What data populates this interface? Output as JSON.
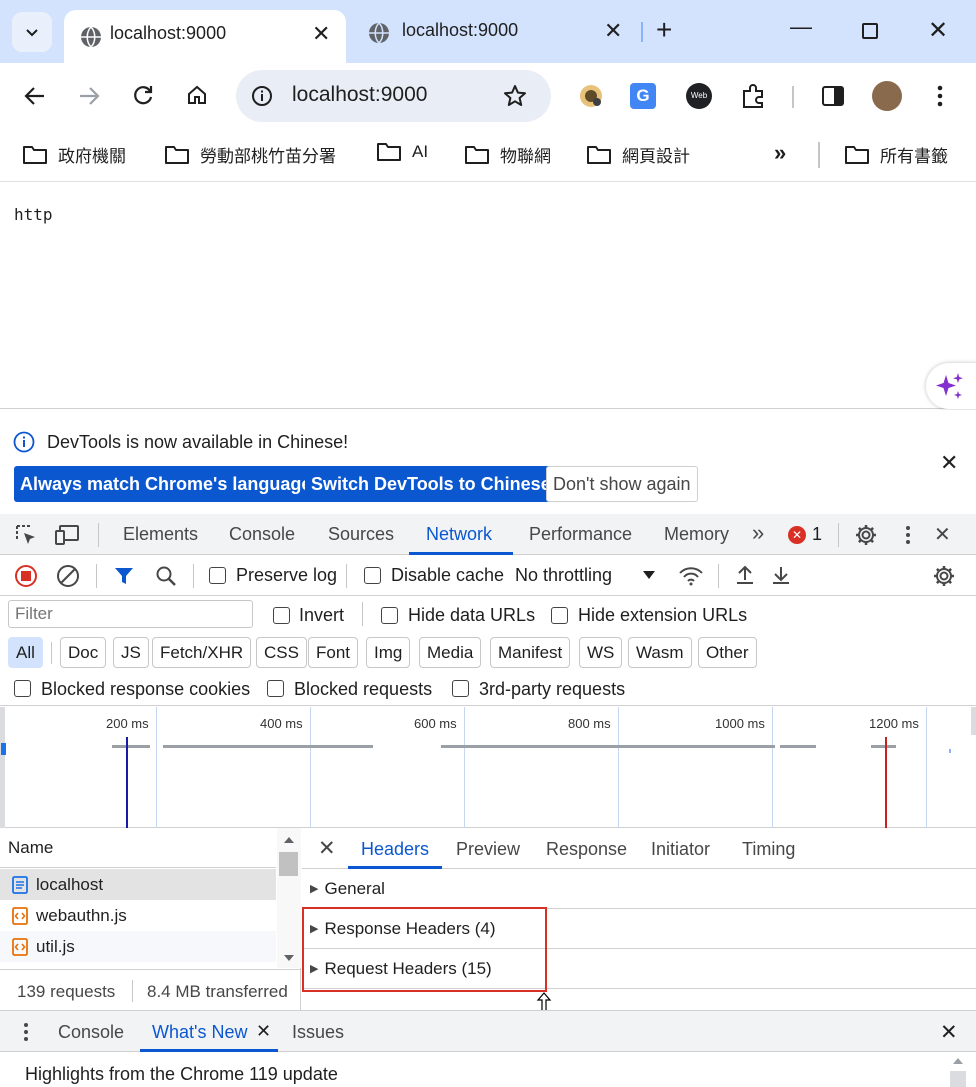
{
  "tabs": [
    {
      "title": "localhost:9000",
      "active": true
    },
    {
      "title": "localhost:9000",
      "active": false
    }
  ],
  "toolbar": {
    "url": "localhost:9000"
  },
  "bookmarks": [
    "政府機關",
    "勞動部桃竹苗分署",
    "AI",
    "物聯網",
    "網頁設計",
    "所有書籤"
  ],
  "page": {
    "body_text": "http"
  },
  "infobar": {
    "message": "DevTools is now available in Chinese!",
    "btn_match": "Always match Chrome's language",
    "btn_switch": "Switch DevTools to Chinese",
    "btn_dismiss": "Don't show again"
  },
  "devtools": {
    "tabs": [
      "Elements",
      "Console",
      "Sources",
      "Network",
      "Performance",
      "Memory"
    ],
    "active_tab": "Network",
    "error_count": "1"
  },
  "network": {
    "preserve_log": "Preserve log",
    "disable_cache": "Disable cache",
    "throttling": "No throttling",
    "filter_placeholder": "Filter",
    "invert": "Invert",
    "hide_data_urls": "Hide data URLs",
    "hide_extension_urls": "Hide extension URLs",
    "type_filters": [
      "All",
      "Doc",
      "JS",
      "Fetch/XHR",
      "CSS",
      "Font",
      "Img",
      "Media",
      "Manifest",
      "WS",
      "Wasm",
      "Other"
    ],
    "blocked_cookies": "Blocked response cookies",
    "blocked_requests": "Blocked requests",
    "third_party": "3rd-party requests",
    "timeline_ticks": [
      "200 ms",
      "400 ms",
      "600 ms",
      "800 ms",
      "1000 ms",
      "1200 ms"
    ],
    "name_header": "Name",
    "requests": [
      {
        "name": "localhost",
        "type": "doc"
      },
      {
        "name": "webauthn.js",
        "type": "script"
      },
      {
        "name": "util.js",
        "type": "script"
      }
    ],
    "summary_requests": "139 requests",
    "summary_transferred": "8.4 MB transferred",
    "detail_tabs": [
      "Headers",
      "Preview",
      "Response",
      "Initiator",
      "Timing"
    ],
    "detail_active": "Headers",
    "sections": [
      "General",
      "Response Headers (4)",
      "Request Headers (15)"
    ]
  },
  "drawer": {
    "tabs": [
      "Console",
      "What's New",
      "Issues"
    ],
    "active": "What's New",
    "content": "Highlights from the Chrome 119 update"
  },
  "colors": {
    "accent": "#0b57d0",
    "tabstrip": "#d3e3fd",
    "highlight_box": "#d93025",
    "error": "#d93025"
  }
}
